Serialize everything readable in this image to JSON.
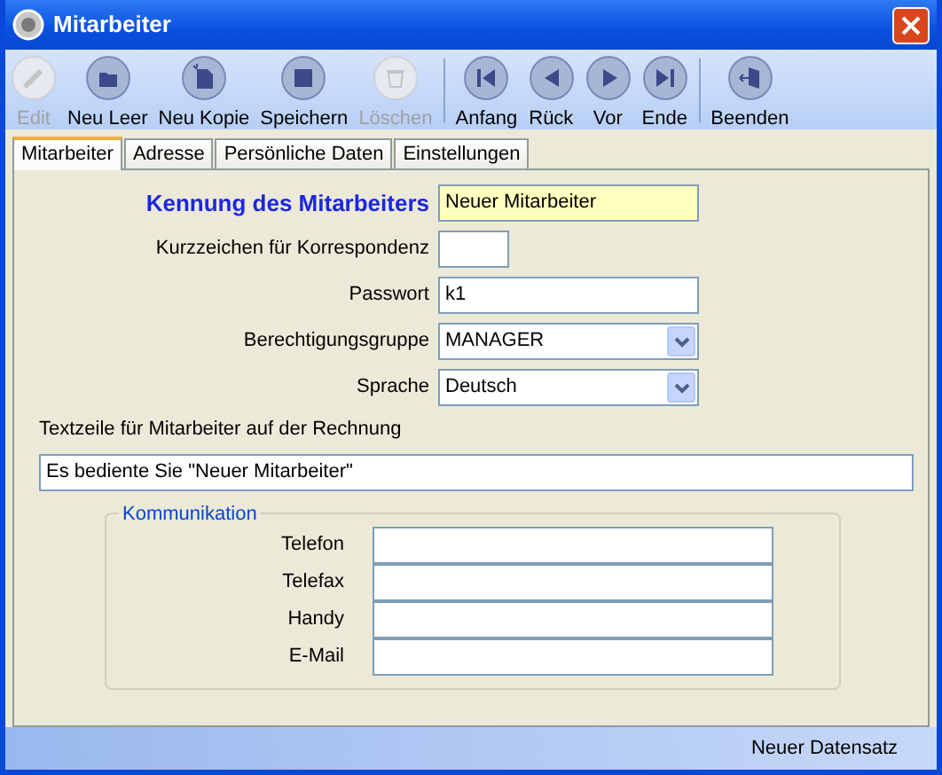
{
  "window": {
    "title": "Mitarbeiter"
  },
  "toolbar": {
    "groups": [
      [
        {
          "label": "Edit",
          "kind": "edit",
          "disabled": true
        },
        {
          "label": "Neu Leer",
          "kind": "folder",
          "disabled": false
        },
        {
          "label": "Neu Kopie",
          "kind": "copy",
          "disabled": false
        },
        {
          "label": "Speichern",
          "kind": "save",
          "disabled": false
        },
        {
          "label": "Löschen",
          "kind": "trash",
          "disabled": true
        }
      ],
      [
        {
          "label": "Anfang",
          "kind": "first",
          "disabled": false
        },
        {
          "label": "Rück",
          "kind": "prev",
          "disabled": false
        },
        {
          "label": "Vor",
          "kind": "next",
          "disabled": false
        },
        {
          "label": "Ende",
          "kind": "last",
          "disabled": false
        }
      ],
      [
        {
          "label": "Beenden",
          "kind": "exit",
          "disabled": false
        }
      ]
    ]
  },
  "tabs": [
    {
      "label": "Mitarbeiter",
      "selected": true
    },
    {
      "label": "Adresse",
      "selected": false
    },
    {
      "label": "Persönliche Daten",
      "selected": false
    },
    {
      "label": "Einstellungen",
      "selected": false
    }
  ],
  "form": {
    "fields": [
      {
        "label": "Kennung des Mitarbeiters",
        "value": "Neuer Mitarbeiter",
        "kind": "key"
      },
      {
        "label": "Kurzzeichen für Korrespondenz",
        "kind": "short"
      },
      {
        "label": "Passwort",
        "value": "k1",
        "kind": "text"
      },
      {
        "label": "Berechtigungsgruppe",
        "value": "MANAGER",
        "kind": "select"
      },
      {
        "label": "Sprache",
        "value": "Deutsch",
        "kind": "select"
      }
    ],
    "invoice_line": {
      "label": "Textzeile für Mitarbeiter auf der Rechnung",
      "value": "Es bediente Sie \"Neuer Mitarbeiter\""
    },
    "communication": {
      "title": "Kommunikation",
      "fields": [
        {
          "label": "Telefon"
        },
        {
          "label": "Telefax"
        },
        {
          "label": "Handy"
        },
        {
          "label": "E-Mail"
        }
      ]
    }
  },
  "status_bar": {
    "text": "Neuer Datensatz"
  }
}
